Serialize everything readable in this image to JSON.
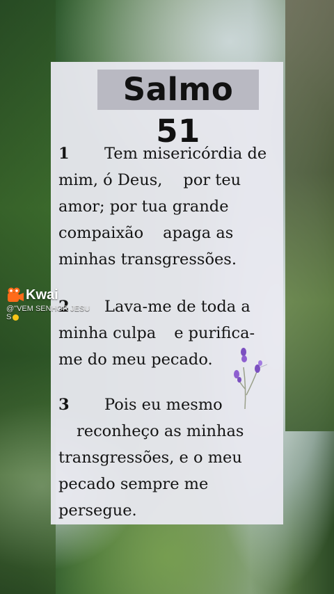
{
  "title": "Salmo 51",
  "verses": [
    {
      "number": "1",
      "lines": [
        "Tem misericórdia de",
        "mim, ó Deus,",
        "por teu",
        "amor; por tua grande",
        "compaixão",
        "apaga as",
        "minhas transgressões."
      ]
    },
    {
      "number": "2",
      "lines": [
        "Lava-me de toda a",
        "minha culpa",
        "e purifica-",
        "me do meu pecado."
      ]
    },
    {
      "number": "3",
      "lines": [
        "Pois eu mesmo",
        "reconheço as minhas",
        "transgressões, e o meu",
        "pecado sempre me",
        "persegue."
      ]
    }
  ],
  "watermark": {
    "brand": "Kwai",
    "handle_line1": "@\"VEM SENHOR JESU",
    "handle_line2": "S"
  },
  "colors": {
    "card": "#e9e9f0",
    "title_highlight": "#b9b9c2",
    "text": "#141414",
    "kwai_orange": "#ff6b1a",
    "lavender": "#7b4fc0"
  },
  "icons": [
    "kwai-logo-icon",
    "lavender-flower-icon",
    "sun-emoji-icon"
  ]
}
